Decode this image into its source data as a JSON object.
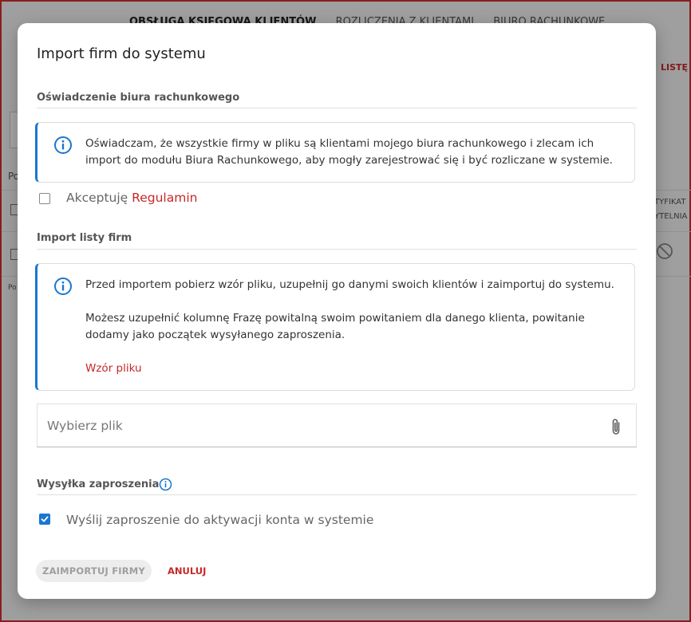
{
  "background": {
    "nav_tabs": [
      "OBSŁUGA KSIĘGOWA KLIENTÓW",
      "ROZLICZENIA Z KLIENTAMI",
      "BIURO RACHUNKOWE"
    ],
    "right_link": "LISTĘ",
    "po_text_1": "Po",
    "po_text_2": "Po",
    "col_label_1": "TYFIKAT",
    "col_label_2": "YTELNIA"
  },
  "modal": {
    "title": "Import firm do systemu",
    "declaration_section": {
      "title": "Oświadczenie biura rachunkowego",
      "info_text": "Oświadczam, że wszystkie firmy w pliku są klientami mojego biura rachunkowego i zlecam ich import do modułu Biura Rachunkowego, aby mogły zarejestrować się i być rozliczane w systemie.",
      "accept_prefix": "Akceptuję ",
      "accept_link": "Regulamin",
      "accepted": false
    },
    "import_section": {
      "title": "Import listy firm",
      "info_para1": "Przed importem pobierz wzór pliku, uzupełnij go danymi swoich klientów i zaimportuj do systemu.",
      "info_para2": "Możesz uzupełnić kolumnę Frazę powitalną swoim powitaniem dla danego klienta, powitanie dodamy jako początek wysyłanego zaproszenia.",
      "template_link": "Wzór pliku",
      "file_placeholder": "Wybierz plik"
    },
    "invitation_section": {
      "title": "Wysyłka zaproszenia",
      "send_label": "Wyślij zaproszenie do aktywacji konta w systemie",
      "send_checked": true
    },
    "buttons": {
      "import": "ZAIMPORTUJ FIRMY",
      "cancel": "ANULUJ"
    }
  },
  "colors": {
    "accent_blue": "#1976d2",
    "accent_red": "#c62828"
  },
  "icons": {
    "info": "info-circle-icon",
    "attach": "paperclip-icon",
    "check": "check-icon",
    "ban": "ban-icon"
  }
}
